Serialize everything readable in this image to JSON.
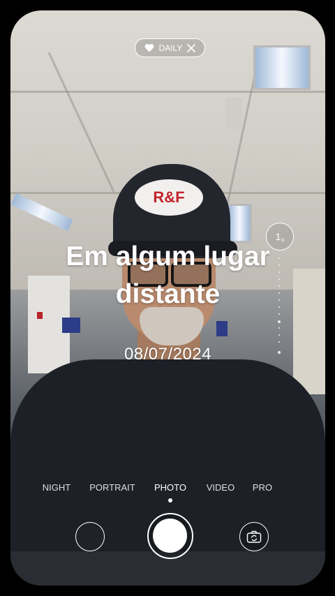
{
  "daily_badge": {
    "label": "DAILY",
    "icon": "heart-icon",
    "close_icon": "close-icon"
  },
  "zoom": {
    "value": "1",
    "unit": "x"
  },
  "overlay": {
    "title": "Em algum lugar distante",
    "date": "08/07/2024"
  },
  "camera_modes": [
    {
      "label": "NIGHT",
      "active": false
    },
    {
      "label": "PORTRAIT",
      "active": false
    },
    {
      "label": "PHOTO",
      "active": true
    },
    {
      "label": "VIDEO",
      "active": false
    },
    {
      "label": "PRO",
      "active": false
    }
  ],
  "cap_logo": "R&F",
  "controls": {
    "gallery_icon": "gallery-thumbnail",
    "shutter_icon": "shutter-button",
    "flip_icon": "camera-flip-icon"
  }
}
